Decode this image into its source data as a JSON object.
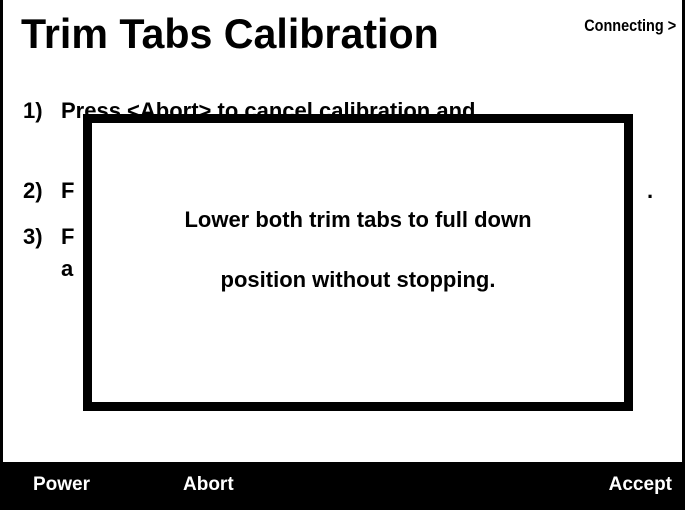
{
  "header": {
    "title": "Trim Tabs Calibration",
    "status": "Connecting >"
  },
  "steps": [
    {
      "number": "1)",
      "text": "Press <Abort> to cancel calibration and"
    },
    {
      "number": "2)",
      "text": "F",
      "tail": "."
    },
    {
      "number": "3)",
      "text": "F",
      "continuation": "a"
    }
  ],
  "dialog": {
    "line1": "Lower both trim tabs to full down",
    "line2": "position without stopping."
  },
  "softkeys": {
    "power": "Power",
    "abort": "Abort",
    "accept": "Accept"
  }
}
